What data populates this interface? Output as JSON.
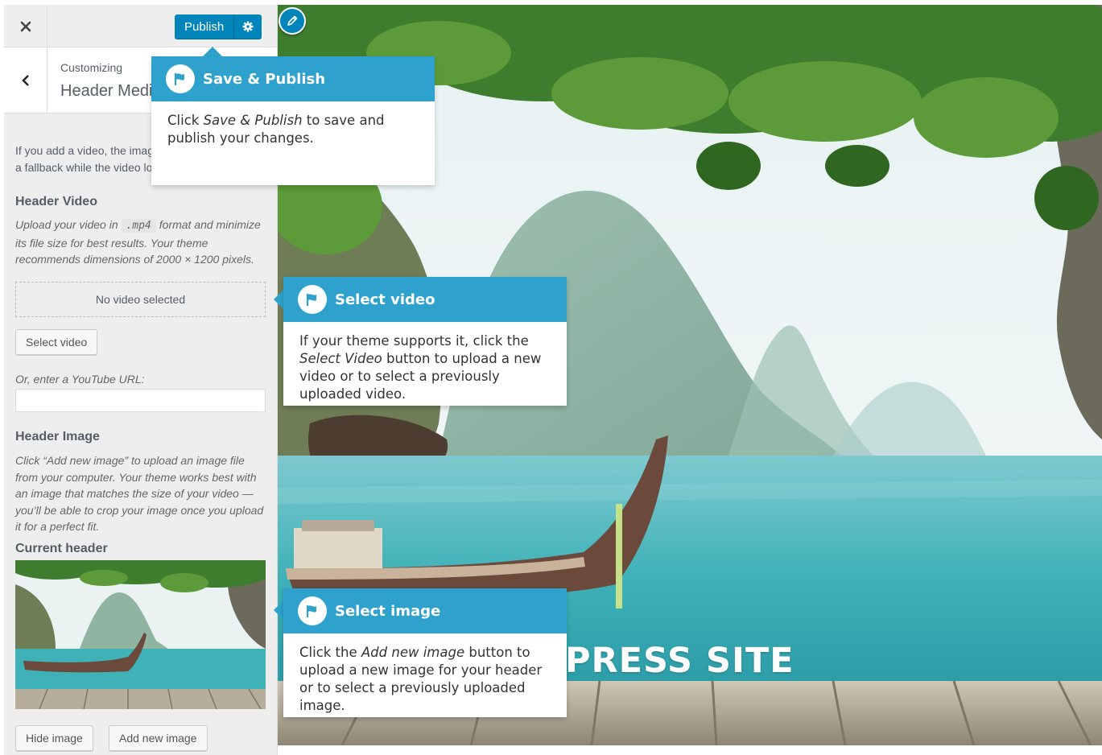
{
  "topbar": {
    "close_icon": "close-icon",
    "publish_label": "Publish",
    "settings_icon": "gear-icon"
  },
  "section": {
    "back_icon": "chevron-left-icon",
    "customizing": "Customizing",
    "title": "Header Media"
  },
  "panel": {
    "intro_line1": "If you add a video, the image will be used as",
    "intro_line2": "a fallback while the video loads.",
    "header_video": {
      "label": "Header Video",
      "desc_before": "Upload your video in ",
      "format": ".mp4",
      "desc_after": " format and minimize its file size for best results. Your theme recommends dimensions of 2000 × 1200 pixels.",
      "placeholder": "No video selected",
      "select_button": "Select video",
      "youtube_label": "Or, enter a YouTube URL:",
      "youtube_value": ""
    },
    "header_image": {
      "label": "Header Image",
      "desc": "Click “Add new image” to upload an image file from your computer. Your theme works best with an image that matches the size of your video — you’ll be able to crop your image once you upload it for a perfect fit.",
      "current_label": "Current header",
      "hide_button": "Hide image",
      "add_button": "Add new image"
    }
  },
  "preview": {
    "site_title": "PRESS SITE",
    "edit_icon": "pencil-icon"
  },
  "pointers": [
    {
      "title": "Save & Publish",
      "body_before": "Click ",
      "body_em": "Save & Publish",
      "body_after": " to save and publish your changes."
    },
    {
      "title": "Select video",
      "body_before": "If your theme supports it, click the ",
      "body_em": "Select Video",
      "body_after": " button to upload a new video or to select a previously uploaded video."
    },
    {
      "title": "Select image",
      "body_before": "Click the ",
      "body_em": "Add new image",
      "body_after": " button to upload a new image for your header or to select a previously uploaded image."
    }
  ],
  "colors": {
    "accent": "#0085ba",
    "pointer": "#2ea2cc",
    "sidebar_bg": "#eeeeee"
  }
}
